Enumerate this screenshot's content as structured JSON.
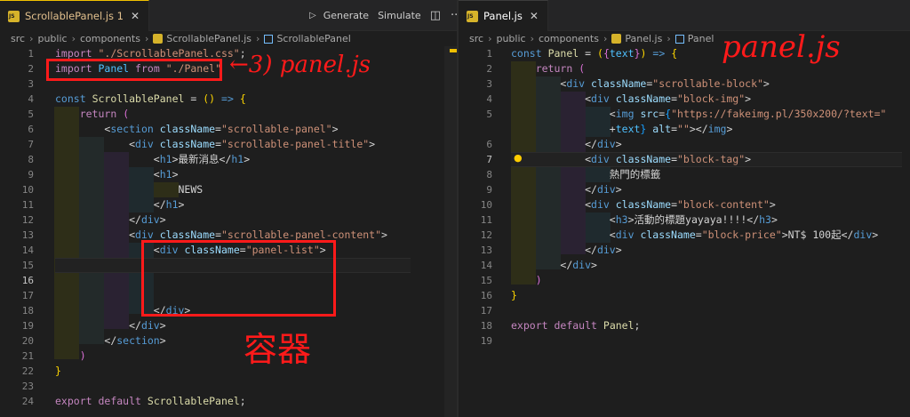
{
  "left": {
    "tab": {
      "label": "ScrollablePanel.js 1",
      "close": "✕"
    },
    "actions": {
      "play": "▷",
      "generate": "Generate",
      "simulate": "Simulate",
      "split": "◫",
      "more": "···"
    },
    "breadcrumb": [
      "src",
      "public",
      "components",
      "ScrollablePanel.js",
      "ScrollablePanel"
    ],
    "lines": [
      {
        "n": "1",
        "html": "<span class='kw2'>import</span> <span class='str'>\"./ScrollablePanel.css\"</span><span class='pl'>;</span>"
      },
      {
        "n": "2",
        "html": "<span class='kw2'>import</span> <span class='var'>Panel</span> <span class='kw2'>from</span> <span class='str'>\"./Panel\"</span>"
      },
      {
        "n": "3",
        "html": ""
      },
      {
        "n": "4",
        "html": "<span class='kw'>const</span> <span class='fn'>ScrollablePanel</span> <span class='pl'>=</span> <span class='brk'>()</span> <span class='kw'>=&gt;</span> <span class='brk'>{</span>"
      },
      {
        "n": "5",
        "html": "    <span class='kw2'>return</span> <span class='br2'>(</span>"
      },
      {
        "n": "6",
        "html": "        <span class='pl'>&lt;</span><span class='tag'>section</span> <span class='attr'>className</span><span class='pl'>=</span><span class='str'>\"scrollable-panel\"</span><span class='pl'>&gt;</span>"
      },
      {
        "n": "7",
        "html": "            <span class='pl'>&lt;</span><span class='tag'>div</span> <span class='attr'>className</span><span class='pl'>=</span><span class='str'>\"scrollable-panel-title\"</span><span class='pl'>&gt;</span>"
      },
      {
        "n": "8",
        "html": "                <span class='pl'>&lt;</span><span class='tag'>h1</span><span class='pl'>&gt;</span>最新消息<span class='pl'>&lt;/</span><span class='tag'>h1</span><span class='pl'>&gt;</span>"
      },
      {
        "n": "9",
        "html": "                <span class='pl'>&lt;</span><span class='tag'>h1</span><span class='pl'>&gt;</span>"
      },
      {
        "n": "10",
        "html": "                    NEWS"
      },
      {
        "n": "11",
        "html": "                <span class='pl'>&lt;/</span><span class='tag'>h1</span><span class='pl'>&gt;</span>"
      },
      {
        "n": "12",
        "html": "            <span class='pl'>&lt;/</span><span class='tag'>div</span><span class='pl'>&gt;</span>"
      },
      {
        "n": "13",
        "html": "            <span class='pl'>&lt;</span><span class='tag'>div</span> <span class='attr'>className</span><span class='pl'>=</span><span class='str'>\"scrollable-panel-content\"</span><span class='pl'>&gt;</span>"
      },
      {
        "n": "14",
        "html": "                <span class='pl'>&lt;</span><span class='tag'>div</span> <span class='attr'>className</span><span class='pl'>=</span><span class='str'>\"panel-list\"</span><span class='pl'>&gt;</span>"
      },
      {
        "n": "15",
        "html": ""
      },
      {
        "n": "16",
        "html": ""
      },
      {
        "n": "17",
        "html": ""
      },
      {
        "n": "18",
        "html": "                <span class='pl'>&lt;/</span><span class='tag'>div</span><span class='pl'>&gt;</span>"
      },
      {
        "n": "19",
        "html": "            <span class='pl'>&lt;/</span><span class='tag'>div</span><span class='pl'>&gt;</span>"
      },
      {
        "n": "20",
        "html": "        <span class='pl'>&lt;/</span><span class='tag'>section</span><span class='pl'>&gt;</span>"
      },
      {
        "n": "21",
        "html": "    <span class='br2'>)</span>"
      },
      {
        "n": "22",
        "html": "<span class='brk'>}</span>"
      },
      {
        "n": "23",
        "html": ""
      },
      {
        "n": "24",
        "html": "<span class='kw2'>export</span> <span class='kw2'>default</span> <span class='fn'>ScrollablePanel</span><span class='pl'>;</span>"
      }
    ],
    "annotation_arrow": "←3) panel.js",
    "annotation_container": "容器"
  },
  "right": {
    "tab": {
      "label": "Panel.js",
      "close": "✕"
    },
    "breadcrumb": [
      "src",
      "public",
      "components",
      "Panel.js",
      "Panel"
    ],
    "lines": [
      {
        "n": "1",
        "html": "<span class='kw'>const</span> <span class='fn'>Panel</span> <span class='pl'>=</span> <span class='brk'>(</span><span class='br2'>{</span><span class='var'>text</span><span class='br2'>}</span><span class='brk'>)</span> <span class='kw'>=&gt;</span> <span class='brk'>{</span>"
      },
      {
        "n": "2",
        "html": "    <span class='kw2'>return</span> <span class='br2'>(</span>"
      },
      {
        "n": "3",
        "html": "        <span class='pl'>&lt;</span><span class='tag'>div</span> <span class='attr'>className</span><span class='pl'>=</span><span class='str'>\"scrollable-block\"</span><span class='pl'>&gt;</span>"
      },
      {
        "n": "4",
        "html": "            <span class='pl'>&lt;</span><span class='tag'>div</span> <span class='attr'>className</span><span class='pl'>=</span><span class='str'>\"block-img\"</span><span class='pl'>&gt;</span>"
      },
      {
        "n": "5",
        "html": "                <span class='pl'>&lt;</span><span class='tag'>img</span> <span class='attr'>src</span><span class='pl'>=</span><span class='br3'>{</span><span class='str'>\"https://fakeimg.pl/350x200/?text=\"</span>"
      },
      {
        "n": "",
        "html": "                <span class='pl'>+</span><span class='var'>text</span><span class='br3'>}</span> <span class='attr'>alt</span><span class='pl'>=</span><span class='str'>\"\"</span><span class='pl'>&gt;&lt;/</span><span class='tag'>img</span><span class='pl'>&gt;</span>"
      },
      {
        "n": "6",
        "html": "            <span class='pl'>&lt;/</span><span class='tag'>div</span><span class='pl'>&gt;</span>"
      },
      {
        "n": "7",
        "html": "            <span class='pl'>&lt;</span><span class='tag'>div</span> <span class='attr'>className</span><span class='pl'>=</span><span class='str'>\"block-tag\"</span><span class='pl'>&gt;</span>"
      },
      {
        "n": "8",
        "html": "                熱門的標籤"
      },
      {
        "n": "9",
        "html": "            <span class='pl'>&lt;/</span><span class='tag'>div</span><span class='pl'>&gt;</span>"
      },
      {
        "n": "10",
        "html": "            <span class='pl'>&lt;</span><span class='tag'>div</span> <span class='attr'>className</span><span class='pl'>=</span><span class='str'>\"block-content\"</span><span class='pl'>&gt;</span>"
      },
      {
        "n": "11",
        "html": "                <span class='pl'>&lt;</span><span class='tag'>h3</span><span class='pl'>&gt;</span>活動的標題yayaya!!!!<span class='pl'>&lt;/</span><span class='tag'>h3</span><span class='pl'>&gt;</span>"
      },
      {
        "n": "12",
        "html": "                <span class='pl'>&lt;</span><span class='tag'>div</span> <span class='attr'>className</span><span class='pl'>=</span><span class='str'>\"block-price\"</span><span class='pl'>&gt;</span>NT$ 100起<span class='pl'>&lt;/</span><span class='tag'>div</span><span class='pl'>&gt;</span>"
      },
      {
        "n": "13",
        "html": "            <span class='pl'>&lt;/</span><span class='tag'>div</span><span class='pl'>&gt;</span>"
      },
      {
        "n": "14",
        "html": "        <span class='pl'>&lt;/</span><span class='tag'>div</span><span class='pl'>&gt;</span>"
      },
      {
        "n": "15",
        "html": "    <span class='br2'>)</span>"
      },
      {
        "n": "16",
        "html": "<span class='brk'>}</span>"
      },
      {
        "n": "17",
        "html": ""
      },
      {
        "n": "18",
        "html": "<span class='kw2'>export</span> <span class='kw2'>default</span> <span class='fn'>Panel</span><span class='pl'>;</span>"
      },
      {
        "n": "19",
        "html": ""
      }
    ],
    "annotation_title": "panel.js"
  }
}
